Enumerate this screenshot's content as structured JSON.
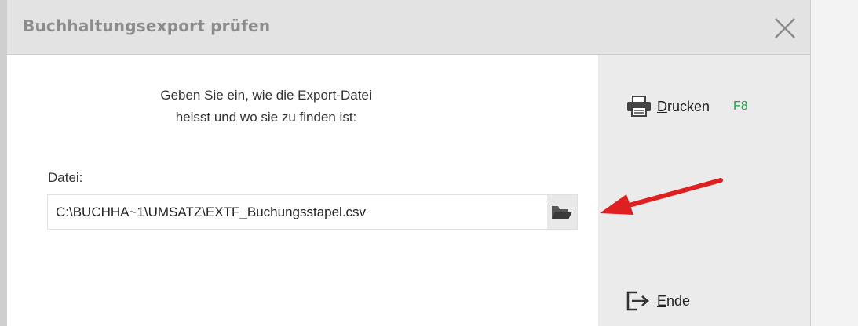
{
  "dialog": {
    "title": "Buchhaltungsexport prüfen",
    "close_icon": "close-icon"
  },
  "main": {
    "prompt_line1": "Geben Sie ein, wie die Export-Datei",
    "prompt_line2": "heisst und wo sie zu finden ist:",
    "file_label": "Datei:",
    "file_value": "C:\\BUCHHA~1\\UMSATZ\\EXTF_Buchungsstapel.csv",
    "browse_icon": "folder-open-icon"
  },
  "side": {
    "print": {
      "mnemonic": "D",
      "rest": "rucken",
      "key": "F8",
      "icon": "printer-icon"
    },
    "end": {
      "mnemonic": "E",
      "rest": "nde",
      "icon": "exit-icon"
    }
  },
  "annotation": {
    "icon": "red-arrow-icon",
    "color": "#e02020"
  },
  "colors": {
    "titlebar": "#e3e3e3",
    "sidebar": "#ebebeb",
    "fkey": "#22a34a"
  }
}
